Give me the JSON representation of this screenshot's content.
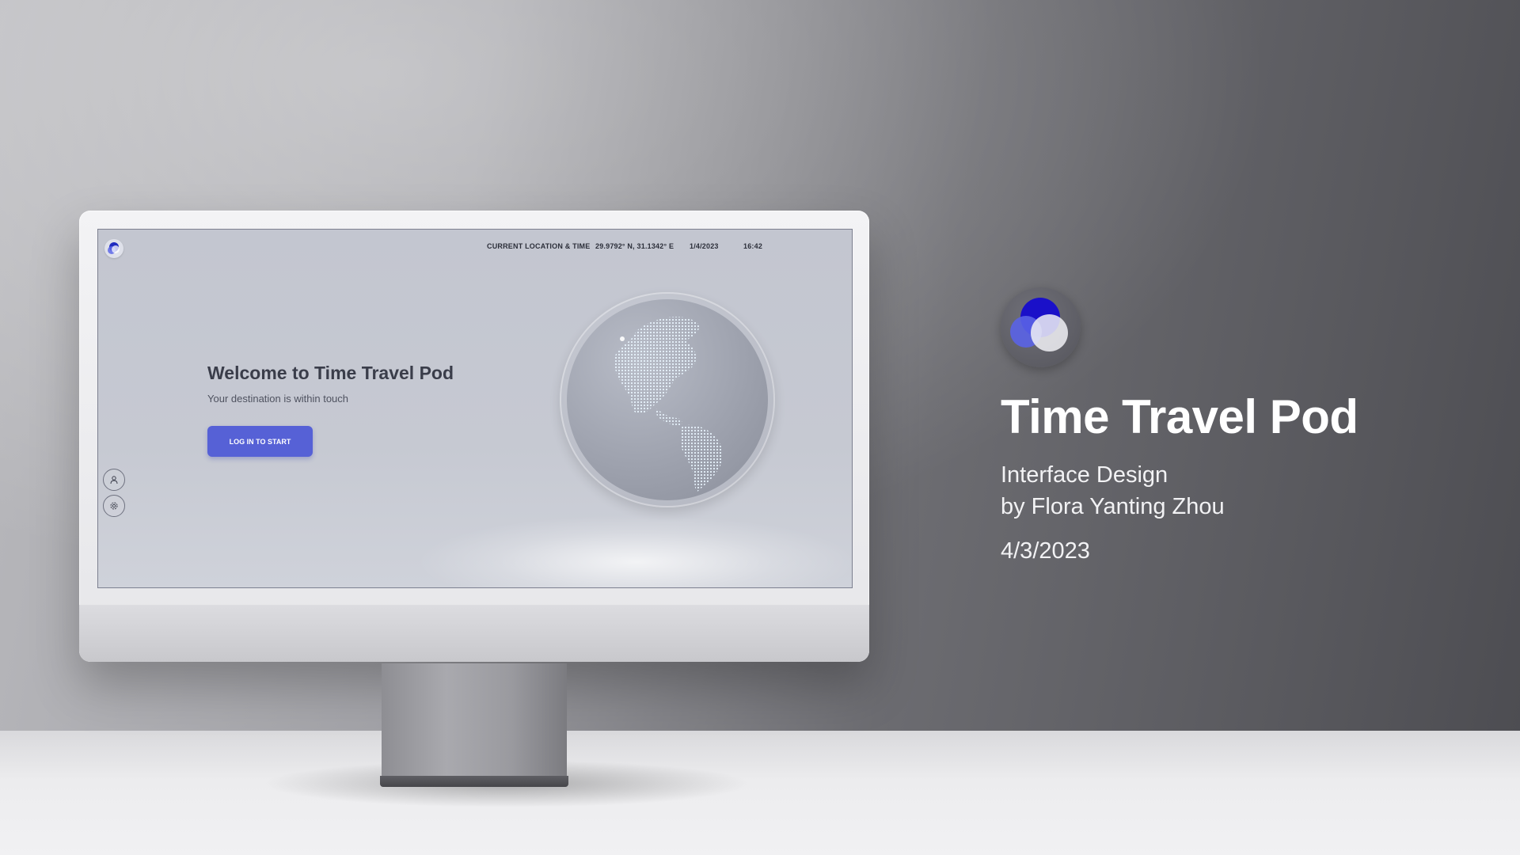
{
  "screen": {
    "status_bar": {
      "location_label": "CURRENT LOCATION & TIME",
      "coordinates": "29.9792° N, 31.1342° E",
      "date": "1/4/2023",
      "time": "16:42"
    },
    "welcome": {
      "title": "Welcome to Time Travel Pod",
      "subtitle": "Your destination is within touch"
    },
    "login_button": {
      "label": "LOG IN TO START"
    },
    "sidebar_icons": [
      "user-icon",
      "settings-icon"
    ],
    "accent_color": "#5661d6"
  },
  "presentation": {
    "title": "Time Travel Pod",
    "subtitle_line1": "Interface Design",
    "subtitle_line2": "by Flora Yanting Zhou",
    "date": "4/3/2023",
    "brand_colors": [
      "#1a10c9",
      "#5a63e6"
    ]
  }
}
